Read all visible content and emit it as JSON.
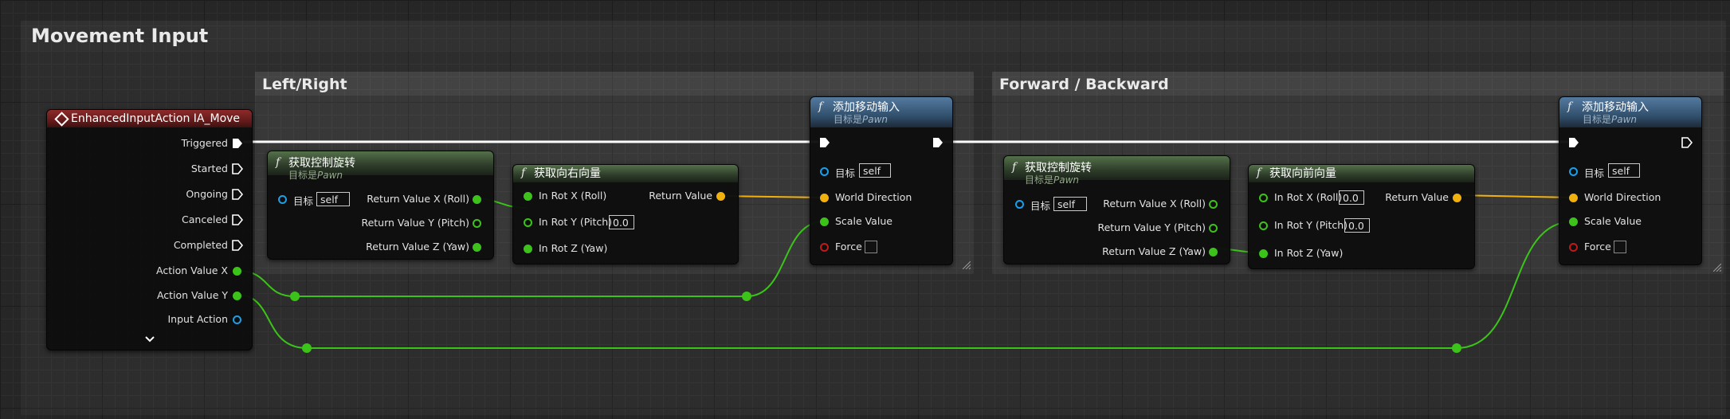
{
  "graph": {
    "comment_main": "Movement Input",
    "comment_left_right": "Left/Right",
    "comment_forward_backward": "Forward / Backward"
  },
  "event_node": {
    "title": "EnhancedInputAction IA_Move",
    "pins": [
      "Triggered",
      "Started",
      "Ongoing",
      "Canceled",
      "Completed",
      "Action Value X",
      "Action Value Y",
      "Input Action"
    ]
  },
  "get_control_rotation": {
    "title": "获取控制旋转",
    "subtitle_prefix": "目标是",
    "subtitle_target": "Pawn",
    "target_label": "目标",
    "target_value": "self",
    "outputs": [
      "Return Value X (Roll)",
      "Return Value Y (Pitch)",
      "Return Value Z (Yaw)"
    ]
  },
  "get_right_vector": {
    "title": "获取向右向量",
    "inputs": [
      "In Rot X (Roll)",
      "In Rot Y (Pitch)",
      "In Rot Z (Yaw)"
    ],
    "pitch_value": "0.0",
    "output": "Return Value"
  },
  "get_forward_vector": {
    "title": "获取向前向量",
    "inputs": [
      "In Rot X (Roll)",
      "In Rot Y (Pitch)",
      "In Rot Z (Yaw)"
    ],
    "roll_value": "0.0",
    "pitch_value": "0.0",
    "output": "Return Value"
  },
  "add_movement_input": {
    "title": "添加移动输入",
    "subtitle_prefix": "目标是",
    "subtitle_target": "Pawn",
    "target_label": "目标",
    "target_value": "self",
    "inputs": [
      "World Direction",
      "Scale Value",
      "Force"
    ]
  },
  "colors": {
    "exec": "#ffffff",
    "float": "#3cc31a",
    "vector": "#f1b00c",
    "object": "#1aa0ea",
    "bool": "#c41818"
  }
}
